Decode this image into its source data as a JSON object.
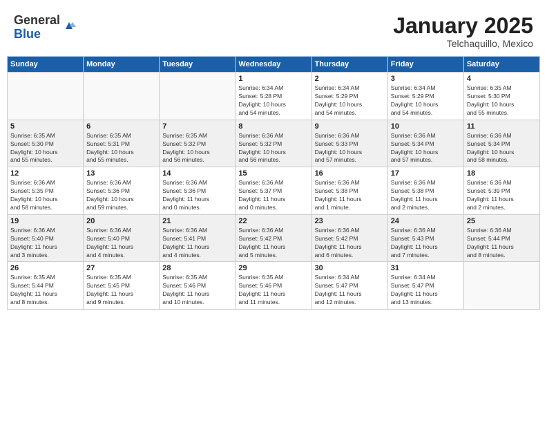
{
  "header": {
    "logo_general": "General",
    "logo_blue": "Blue",
    "month": "January 2025",
    "location": "Telchaquillo, Mexico"
  },
  "weekdays": [
    "Sunday",
    "Monday",
    "Tuesday",
    "Wednesday",
    "Thursday",
    "Friday",
    "Saturday"
  ],
  "weeks": [
    [
      {
        "day": "",
        "info": ""
      },
      {
        "day": "",
        "info": ""
      },
      {
        "day": "",
        "info": ""
      },
      {
        "day": "1",
        "info": "Sunrise: 6:34 AM\nSunset: 5:28 PM\nDaylight: 10 hours\nand 54 minutes."
      },
      {
        "day": "2",
        "info": "Sunrise: 6:34 AM\nSunset: 5:29 PM\nDaylight: 10 hours\nand 54 minutes."
      },
      {
        "day": "3",
        "info": "Sunrise: 6:34 AM\nSunset: 5:29 PM\nDaylight: 10 hours\nand 54 minutes."
      },
      {
        "day": "4",
        "info": "Sunrise: 6:35 AM\nSunset: 5:30 PM\nDaylight: 10 hours\nand 55 minutes."
      }
    ],
    [
      {
        "day": "5",
        "info": "Sunrise: 6:35 AM\nSunset: 5:30 PM\nDaylight: 10 hours\nand 55 minutes."
      },
      {
        "day": "6",
        "info": "Sunrise: 6:35 AM\nSunset: 5:31 PM\nDaylight: 10 hours\nand 55 minutes."
      },
      {
        "day": "7",
        "info": "Sunrise: 6:35 AM\nSunset: 5:32 PM\nDaylight: 10 hours\nand 56 minutes."
      },
      {
        "day": "8",
        "info": "Sunrise: 6:36 AM\nSunset: 5:32 PM\nDaylight: 10 hours\nand 56 minutes."
      },
      {
        "day": "9",
        "info": "Sunrise: 6:36 AM\nSunset: 5:33 PM\nDaylight: 10 hours\nand 57 minutes."
      },
      {
        "day": "10",
        "info": "Sunrise: 6:36 AM\nSunset: 5:34 PM\nDaylight: 10 hours\nand 57 minutes."
      },
      {
        "day": "11",
        "info": "Sunrise: 6:36 AM\nSunset: 5:34 PM\nDaylight: 10 hours\nand 58 minutes."
      }
    ],
    [
      {
        "day": "12",
        "info": "Sunrise: 6:36 AM\nSunset: 5:35 PM\nDaylight: 10 hours\nand 58 minutes."
      },
      {
        "day": "13",
        "info": "Sunrise: 6:36 AM\nSunset: 5:36 PM\nDaylight: 10 hours\nand 59 minutes."
      },
      {
        "day": "14",
        "info": "Sunrise: 6:36 AM\nSunset: 5:36 PM\nDaylight: 11 hours\nand 0 minutes."
      },
      {
        "day": "15",
        "info": "Sunrise: 6:36 AM\nSunset: 5:37 PM\nDaylight: 11 hours\nand 0 minutes."
      },
      {
        "day": "16",
        "info": "Sunrise: 6:36 AM\nSunset: 5:38 PM\nDaylight: 11 hours\nand 1 minute."
      },
      {
        "day": "17",
        "info": "Sunrise: 6:36 AM\nSunset: 5:38 PM\nDaylight: 11 hours\nand 2 minutes."
      },
      {
        "day": "18",
        "info": "Sunrise: 6:36 AM\nSunset: 5:39 PM\nDaylight: 11 hours\nand 2 minutes."
      }
    ],
    [
      {
        "day": "19",
        "info": "Sunrise: 6:36 AM\nSunset: 5:40 PM\nDaylight: 11 hours\nand 3 minutes."
      },
      {
        "day": "20",
        "info": "Sunrise: 6:36 AM\nSunset: 5:40 PM\nDaylight: 11 hours\nand 4 minutes."
      },
      {
        "day": "21",
        "info": "Sunrise: 6:36 AM\nSunset: 5:41 PM\nDaylight: 11 hours\nand 4 minutes."
      },
      {
        "day": "22",
        "info": "Sunrise: 6:36 AM\nSunset: 5:42 PM\nDaylight: 11 hours\nand 5 minutes."
      },
      {
        "day": "23",
        "info": "Sunrise: 6:36 AM\nSunset: 5:42 PM\nDaylight: 11 hours\nand 6 minutes."
      },
      {
        "day": "24",
        "info": "Sunrise: 6:36 AM\nSunset: 5:43 PM\nDaylight: 11 hours\nand 7 minutes."
      },
      {
        "day": "25",
        "info": "Sunrise: 6:36 AM\nSunset: 5:44 PM\nDaylight: 11 hours\nand 8 minutes."
      }
    ],
    [
      {
        "day": "26",
        "info": "Sunrise: 6:35 AM\nSunset: 5:44 PM\nDaylight: 11 hours\nand 8 minutes."
      },
      {
        "day": "27",
        "info": "Sunrise: 6:35 AM\nSunset: 5:45 PM\nDaylight: 11 hours\nand 9 minutes."
      },
      {
        "day": "28",
        "info": "Sunrise: 6:35 AM\nSunset: 5:46 PM\nDaylight: 11 hours\nand 10 minutes."
      },
      {
        "day": "29",
        "info": "Sunrise: 6:35 AM\nSunset: 5:46 PM\nDaylight: 11 hours\nand 11 minutes."
      },
      {
        "day": "30",
        "info": "Sunrise: 6:34 AM\nSunset: 5:47 PM\nDaylight: 11 hours\nand 12 minutes."
      },
      {
        "day": "31",
        "info": "Sunrise: 6:34 AM\nSunset: 5:47 PM\nDaylight: 11 hours\nand 13 minutes."
      },
      {
        "day": "",
        "info": ""
      }
    ]
  ]
}
